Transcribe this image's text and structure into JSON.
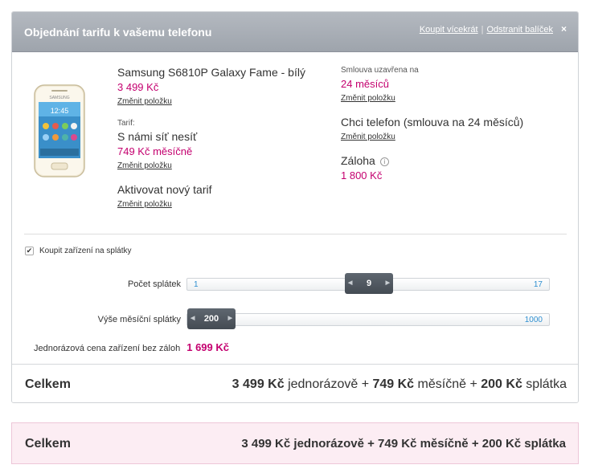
{
  "header": {
    "title": "Objednání tarifu k vašemu telefonu",
    "buy_more": "Koupit vícekrát",
    "separator": "|",
    "remove_package": "Odstranit balíček",
    "close": "×"
  },
  "change_link": "Změnit položku",
  "product": {
    "name": "Samsung S6810P Galaxy Fame - bílý",
    "price": "3 499 Kč",
    "change": "Změnit položku"
  },
  "tariff": {
    "label": "Tarif:",
    "name": "S námi síť nesíť",
    "price": "749 Kč měsíčně",
    "change": "Změnit položku"
  },
  "activation": {
    "name": "Aktivovat nový tarif",
    "change": "Změnit položku"
  },
  "contract": {
    "label": "Smlouva uzavřena na",
    "value": "24 měsíců",
    "change": "Změnit položku"
  },
  "phone_option": {
    "name": "Chci telefon (smlouva na 24 měsíců)",
    "change": "Změnit položku"
  },
  "deposit": {
    "name": "Záloha",
    "info_icon": "info-icon",
    "value": "1 800 Kč"
  },
  "installments": {
    "checkbox_label": "Koupit zařízení na splátky",
    "checked": true,
    "count_label": "Počet splátek",
    "count_min": "1",
    "count_max": "17",
    "count_value": "9",
    "amount_label": "Výše měsíční splátky",
    "amount_value": "200",
    "amount_max": "1000",
    "once_label": "Jednorázová cena zařízení bez záloh",
    "once_value": "1 699 Kč"
  },
  "total": {
    "label": "Celkem",
    "one_time": "3 499 Kč",
    "one_time_suffix": "jednorázově",
    "plus": "+",
    "monthly": "749 Kč",
    "monthly_suffix": "měsíčně",
    "installment": "200 Kč",
    "installment_suffix": "splátka"
  },
  "colors": {
    "accent": "#c4006f",
    "header_bg": "#a9aeb5",
    "slider_thumb": "#4f565e",
    "total_bg": "#fcedf3"
  }
}
